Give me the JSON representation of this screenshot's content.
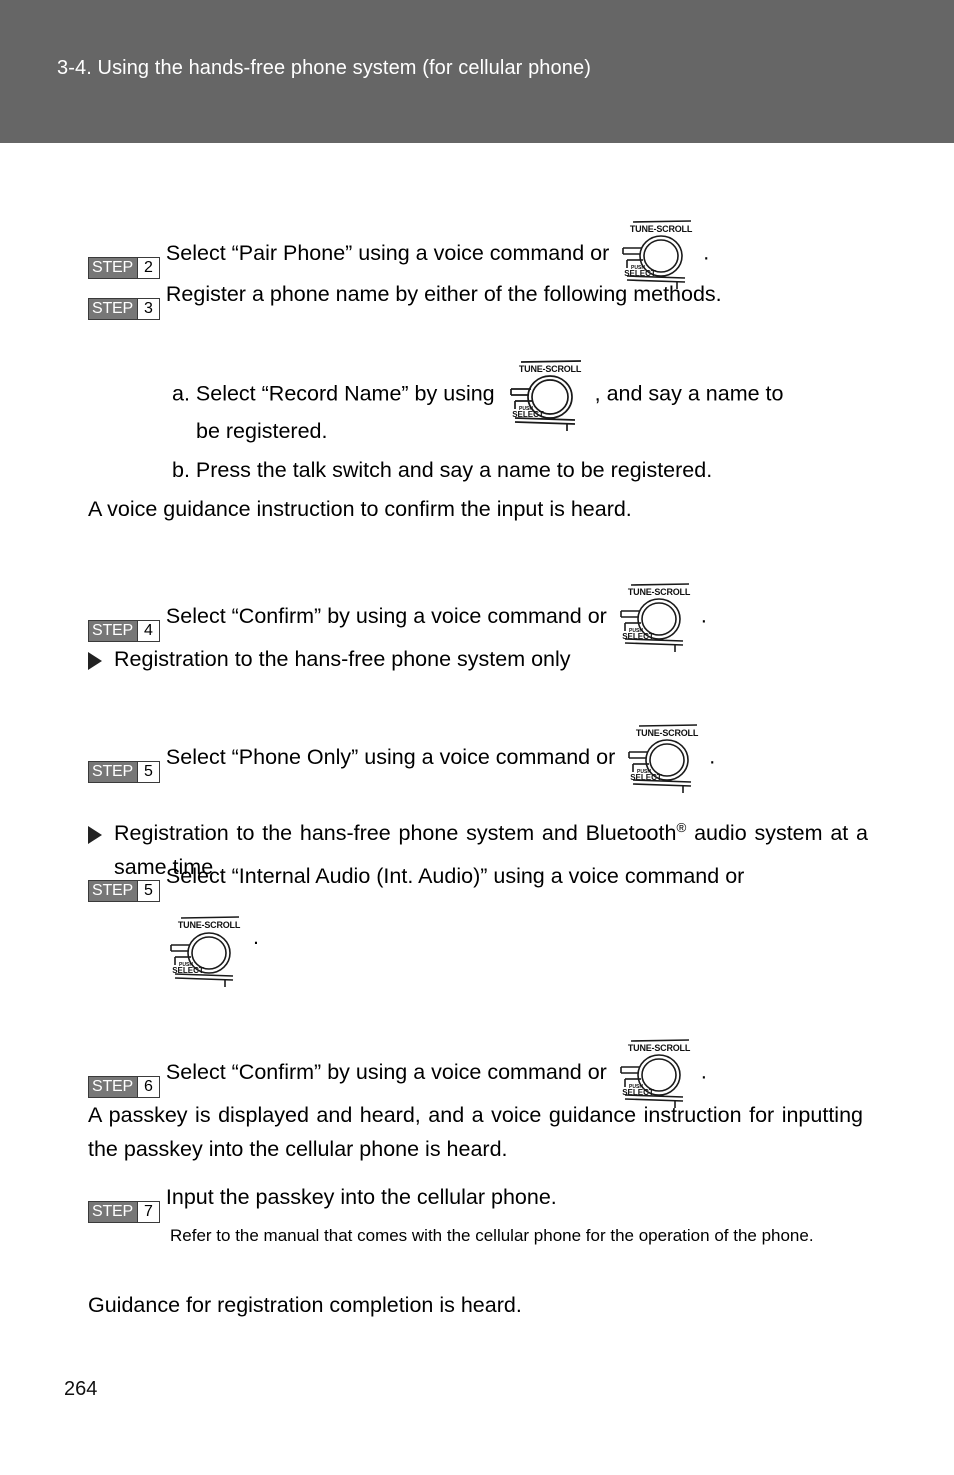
{
  "header": {
    "title": "3-4. Using the hands-free phone system (for cellular phone)",
    "background_color": "#666666",
    "text_color": "#ffffff"
  },
  "icons": {
    "knob": {
      "name": "tune-scroll-knob",
      "top_label": "TUNE-SCROLL",
      "push_label": "PUSH",
      "select_label": "SELECT"
    },
    "triangle_bullet": "triangle-right-marker"
  },
  "steps": {
    "step2": {
      "badge_word": "STEP",
      "badge_number": "2",
      "text_before": "Select “Pair Phone” using a voice command or",
      "text_after": "."
    },
    "step3": {
      "badge_word": "STEP",
      "badge_number": "3",
      "text": "Register a phone name by either of the following methods."
    },
    "step3a": {
      "text_before": "a. Select “Record Name” by using",
      "text_after": ", and say a name to",
      "text_line2": "be registered."
    },
    "step3b": {
      "text": "b. Press the talk switch and say a name to be registered."
    },
    "after_step3": {
      "text": "A voice guidance instruction to confirm the input is heard."
    },
    "step4": {
      "badge_word": "STEP",
      "badge_number": "4",
      "text_before": "Select “Confirm” by using a voice command or",
      "text_after": "."
    },
    "bullet1": {
      "text": "Registration to the hans-free phone system only"
    },
    "step5a": {
      "badge_word": "STEP",
      "badge_number": "5",
      "text_before": "Select “Phone Only” using a voice command or",
      "text_after": "."
    },
    "bullet2": {
      "text_part1": "Registration to the hans-free phone system and Bluetooth",
      "registered_mark": "®",
      "text_part2": " audio system at a same time"
    },
    "step5b": {
      "badge_word": "STEP",
      "badge_number": "5",
      "text": "Select “Internal Audio (Int. Audio)” using a voice command or",
      "trailing_period": "."
    },
    "step6": {
      "badge_word": "STEP",
      "badge_number": "6",
      "text_before": "Select “Confirm” by using a voice command or",
      "text_after": "."
    },
    "after_step6": {
      "text": "A passkey is displayed and heard, and a voice guidance instruction for inputting the passkey into the cellular phone is heard."
    },
    "step7": {
      "badge_word": "STEP",
      "badge_number": "7",
      "text": "Input the passkey into the cellular phone.",
      "note": "Refer to the manual that comes with the cellular phone for the operation of the phone."
    },
    "closing": {
      "text": "Guidance for registration completion is heard."
    }
  },
  "footer": {
    "page_number": "264"
  }
}
